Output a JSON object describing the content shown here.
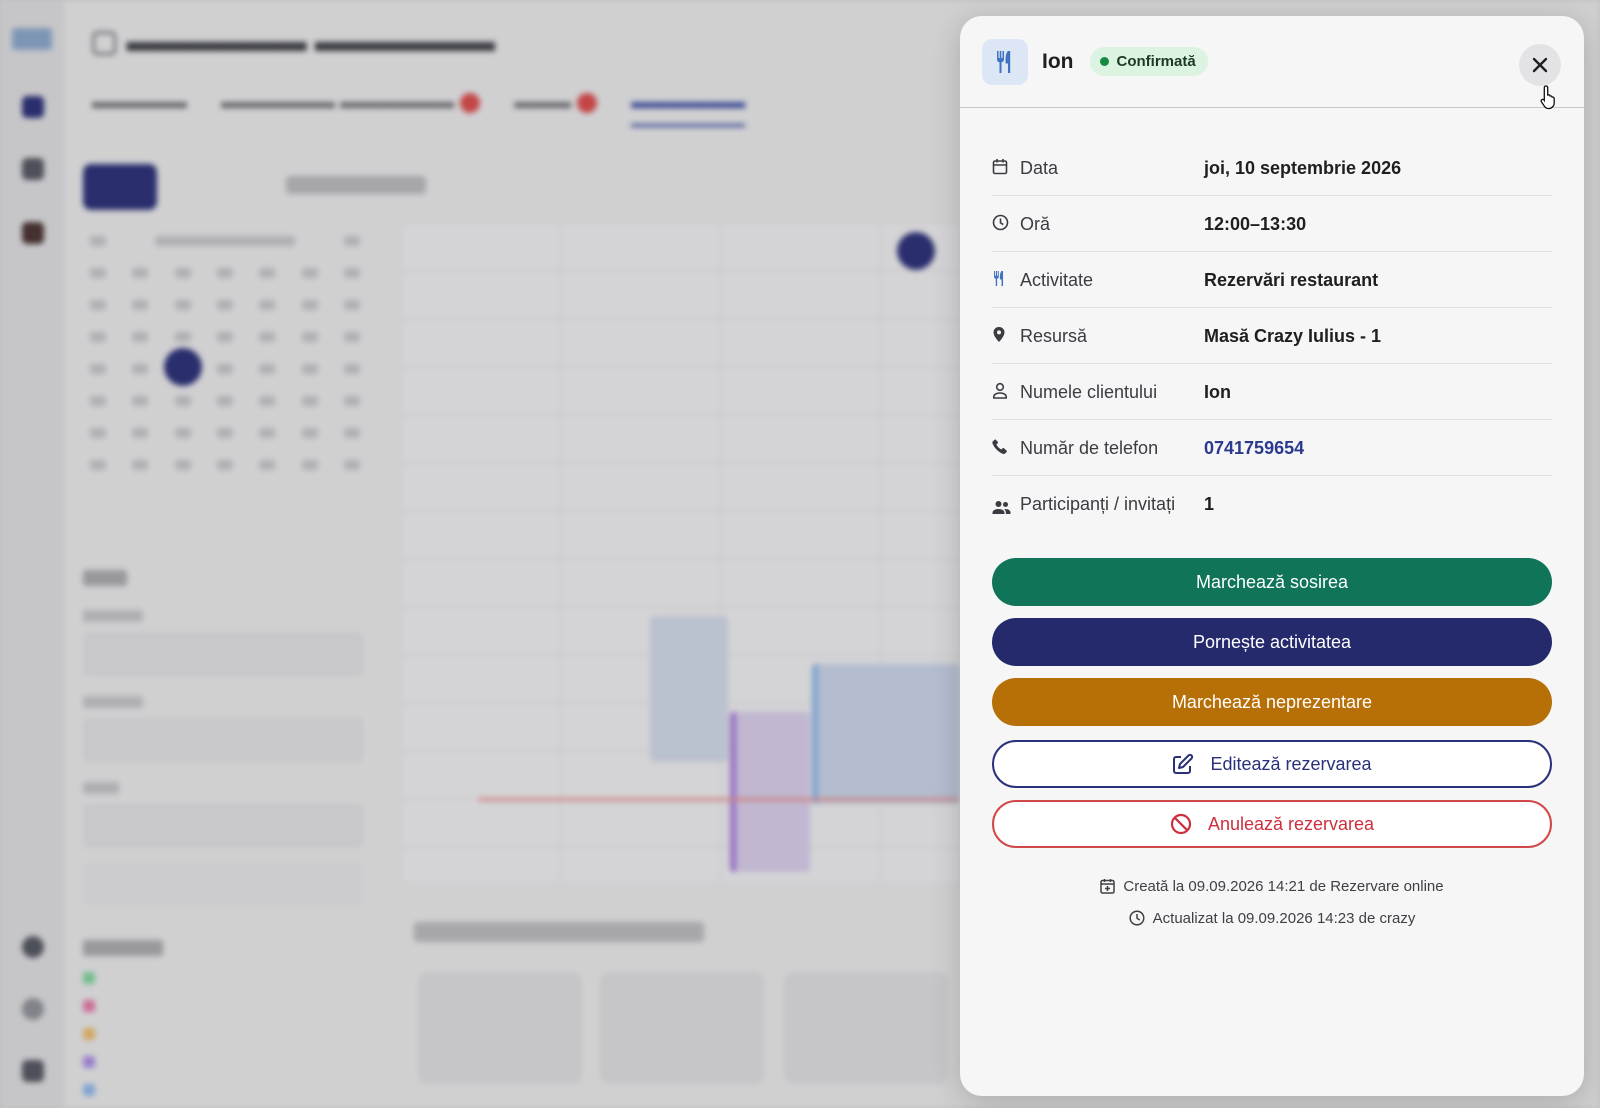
{
  "panel": {
    "client_name": "Ion",
    "status": "Confirmată",
    "details": [
      {
        "icon": "calendar-icon",
        "label": "Data",
        "value": "joi, 10 septembrie 2026"
      },
      {
        "icon": "clock-icon",
        "label": "Oră",
        "value": "12:00–13:30"
      },
      {
        "icon": "fork-knife-icon",
        "label": "Activitate",
        "value": "Rezervări restaurant"
      },
      {
        "icon": "location-pin-icon",
        "label": "Resursă",
        "value": "Masă Crazy Iulius - 1"
      },
      {
        "icon": "person-icon",
        "label": "Numele clientului",
        "value": "Ion"
      },
      {
        "icon": "phone-icon",
        "label": "Număr de telefon",
        "value": "0741759654"
      },
      {
        "icon": "group-icon",
        "label": "Participanți / invitați",
        "value": "1"
      }
    ],
    "actions": {
      "mark_arrival": "Marchează sosirea",
      "start_activity": "Pornește activitatea",
      "mark_no_show": "Marchează neprezentare",
      "edit": "Editează rezervarea",
      "cancel": "Anulează rezervarea"
    },
    "meta": {
      "created": "Creată la 09.09.2026 14:21 de Rezervare online",
      "updated": "Actualizat la 09.09.2026 14:23 de crazy"
    }
  },
  "colors": {
    "green": "#0f7458",
    "navy": "#252a6c",
    "orange": "#b77008",
    "red": "#cc2f3e",
    "confirmed": "#148a43"
  }
}
